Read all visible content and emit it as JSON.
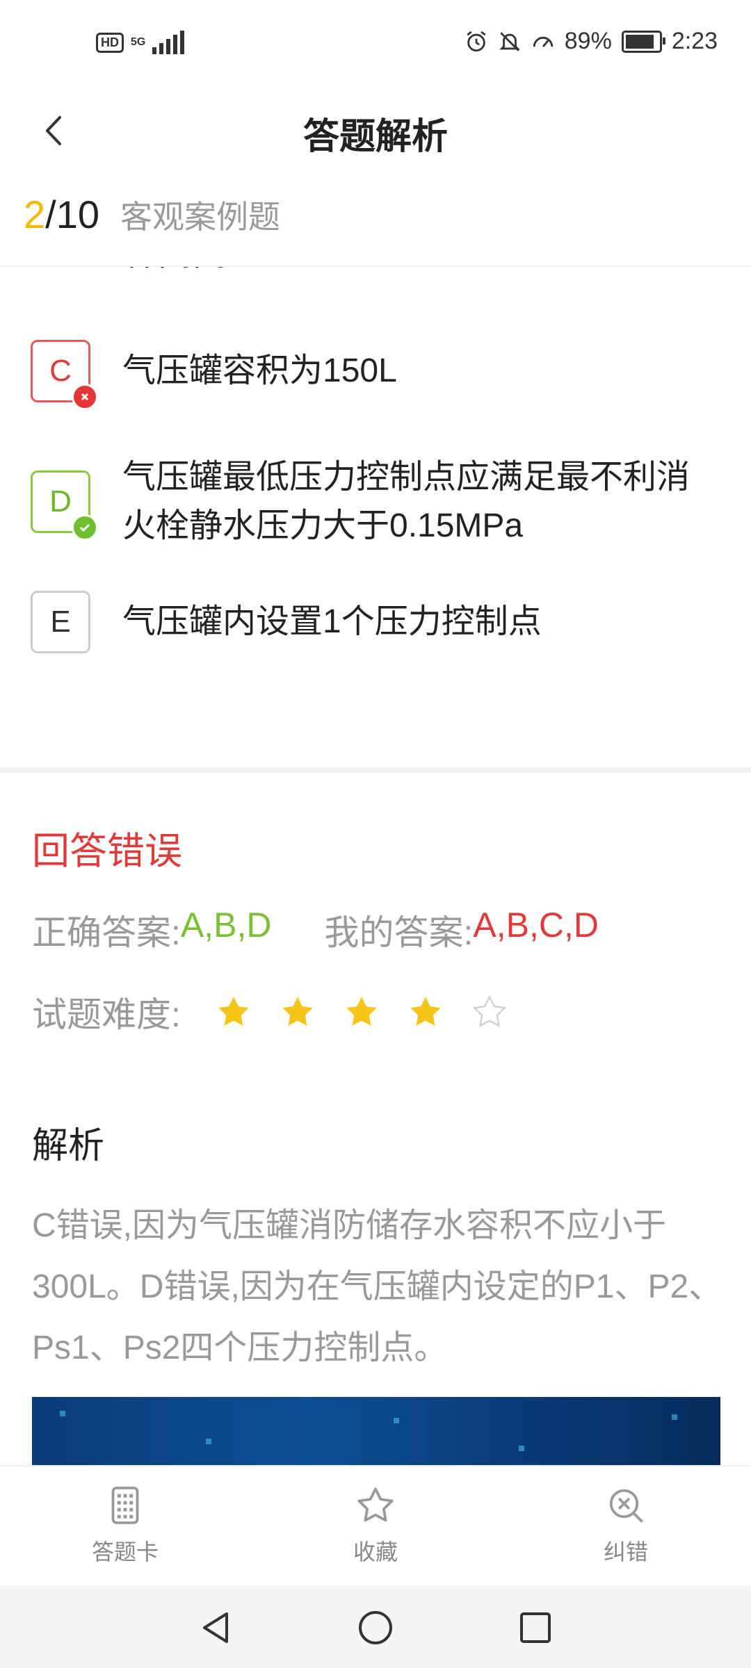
{
  "status_bar": {
    "left_badge": "HD",
    "network": "5G",
    "battery": "89%",
    "time": "2:23"
  },
  "nav": {
    "title": "答题解析"
  },
  "progress": {
    "current": "2",
    "total": "/10",
    "type": "客观案例题"
  },
  "options": {
    "partial_text": "杆闸阀",
    "items": [
      {
        "letter": "C",
        "text": "气压罐容积为150L",
        "status": "wrong"
      },
      {
        "letter": "D",
        "text": "气压罐最低压力控制点应满足最不利消火栓静水压力大于0.15MPa",
        "status": "correct"
      },
      {
        "letter": "E",
        "text": "气压罐内设置1个压力控制点",
        "status": "none"
      }
    ]
  },
  "result": {
    "label": "回答错误",
    "correct_label": "正确答案:",
    "correct_value": "A,B,D",
    "mine_label": "我的答案:",
    "mine_value": "A,B,C,D",
    "difficulty_label": "试题难度:",
    "difficulty_stars": 4,
    "difficulty_max": 5
  },
  "analysis": {
    "title": "解析",
    "text": "C错误,因为气压罐消防储存水容积不应小于300L。D错误,因为在气压罐内设定的P1、P2、Ps1、Ps2四个压力控制点。"
  },
  "tabs": [
    {
      "label": "答题卡",
      "icon": "answer-card-icon"
    },
    {
      "label": "收藏",
      "icon": "star-outline-icon"
    },
    {
      "label": "纠错",
      "icon": "search-x-icon"
    }
  ],
  "colors": {
    "accent_yellow": "#f5b800",
    "correct_green": "#7cbf35",
    "wrong_red": "#e03a3a"
  }
}
